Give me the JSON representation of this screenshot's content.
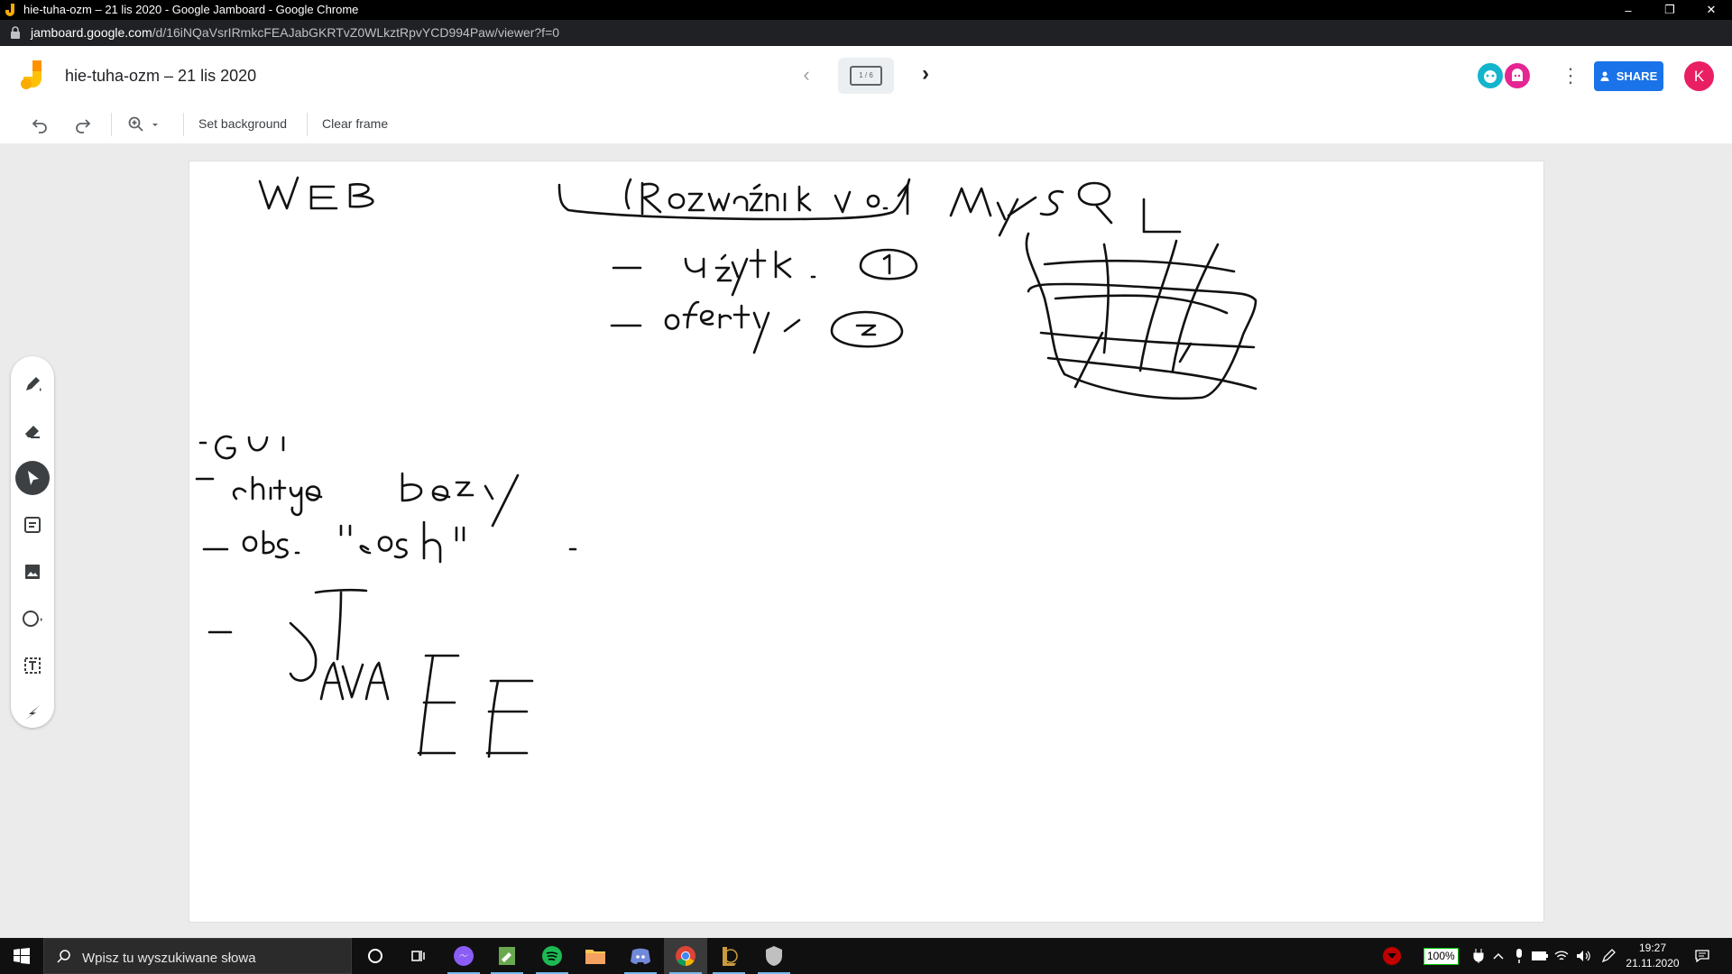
{
  "window": {
    "title": "hie-tuha-ozm – 21 lis 2020 - Google Jamboard - Google Chrome",
    "controls": {
      "minimize": "–",
      "restore": "❐",
      "close": "✕"
    }
  },
  "address_bar": {
    "domain": "jamboard.google.com",
    "path": "/d/16iNQaVsrIRmkcFEAJabGKRTvZ0WLkztRpvYCD994Paw/viewer?f=0"
  },
  "header": {
    "doc_title": "hie-tuha-ozm – 21 lis 2020",
    "frame_indicator": "1 / 6",
    "prev_glyph": "‹",
    "next_glyph": "›",
    "more_glyph": "⋮",
    "share_label": "SHARE",
    "avatar_initial": "K"
  },
  "toolbar": {
    "set_background": "Set background",
    "clear_frame": "Clear frame"
  },
  "side_tools": [
    "pen",
    "eraser",
    "select",
    "sticky-note",
    "image",
    "circle",
    "text-box",
    "laser"
  ],
  "active_tool": "select",
  "taskbar": {
    "search_placeholder": "Wpisz tu wyszukiwane słowa",
    "battery_badge": "100%",
    "time": "19:27",
    "date": "21.11.2020"
  },
  "colors": {
    "share_blue": "#1a73e8",
    "avatar_pink": "#e91e63",
    "collab1": "#12b5cb",
    "collab2": "#e52592"
  }
}
